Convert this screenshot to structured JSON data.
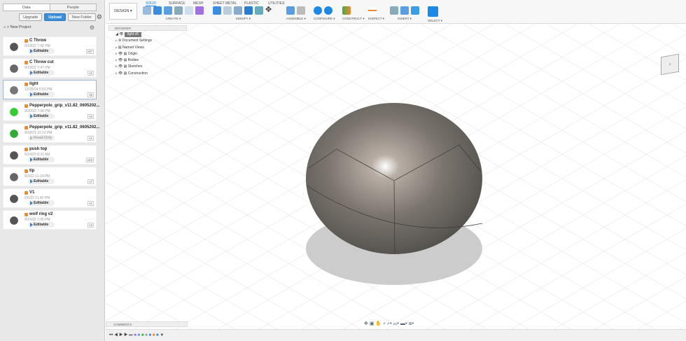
{
  "left": {
    "tabs": [
      "Data",
      "People"
    ],
    "upgrade": "Upgrade",
    "upload": "Upload",
    "new_folder": "New Folder",
    "breadcrumb": "New Project",
    "files": [
      {
        "name": "C Throw",
        "date": "9/19/22 7:42 PM",
        "perm": "Editable",
        "ver": "v37"
      },
      {
        "name": "C Throw cut",
        "date": "9/19/22 7:47 PM",
        "perm": "Editable",
        "ver": "v1"
      },
      {
        "name": "light",
        "date": "12/25/24 5:03 PM",
        "perm": "Editable",
        "ver": "v5"
      },
      {
        "name": "Pepperpole_grip_v11.82_0605202...",
        "date": "9/20/23 7:36 PM",
        "perm": "Editable",
        "ver": "v5"
      },
      {
        "name": "Pepperpole_grip_v11.82_0605202...",
        "date": "9/18/23 10:13 PM",
        "perm": "Read-Only",
        "ver": "v1"
      },
      {
        "name": "push top",
        "date": "5/19/23 8:31 AM",
        "perm": "Editable",
        "ver": "v22"
      },
      {
        "name": "tip",
        "date": "6/3/22 11:14 PM",
        "perm": "Editable",
        "ver": "v7"
      },
      {
        "name": "V1",
        "date": "6/5/22 11:42 PM",
        "perm": "Editable",
        "ver": "v1"
      },
      {
        "name": "wolf ring v2",
        "date": "8/14/22 1:06 PM",
        "perm": "Editable",
        "ver": "v4"
      }
    ]
  },
  "toolbar": {
    "workspace": "DESIGN ▾",
    "tabs": [
      "SOLID",
      "SURFACE",
      "MESH",
      "SHEET METAL",
      "PLASTIC",
      "UTILITIES"
    ],
    "groups": [
      "CREATE ▾",
      "MODIFY ▾",
      "ASSEMBLE ▾",
      "CONFIGURE ▾",
      "CONSTRUCT ▾",
      "INSPECT ▾",
      "INSERT ▾",
      "SELECT ▾"
    ]
  },
  "browser": {
    "title": "BROWSER",
    "root": "light v5",
    "items": [
      "Document Settings",
      "Named Views",
      "Origin",
      "Bodies",
      "Sketches",
      "Construction"
    ]
  },
  "comments": "COMMENTS",
  "viewcube": "Z",
  "colors": {
    "accent": "#1e88e5",
    "upload": "#3b8ed8"
  }
}
